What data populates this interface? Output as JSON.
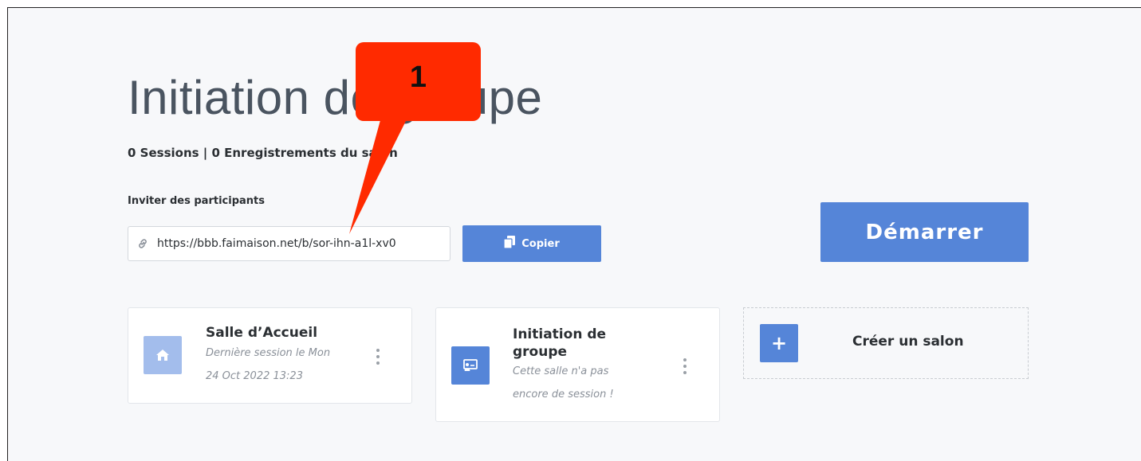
{
  "room": {
    "title": "Initiation de groupe",
    "stats": "0 Sessions | 0 Enregistrements du salon"
  },
  "invite": {
    "label": "Inviter des participants",
    "url": "https://bbb.faimaison.net/b/sor-ihn-a1l-xv0",
    "link_icon": "link-icon",
    "copy_label": "Copier",
    "copy_icon": "copy-icon"
  },
  "start_label": "Démarrer",
  "rooms": [
    {
      "title": "Salle d’Accueil",
      "subtitle_lines": [
        "Dernière session le Mon",
        "24 Oct 2022 13:23"
      ],
      "icon": "home-icon"
    },
    {
      "title_lines": [
        "Initiation de",
        "groupe"
      ],
      "subtitle_lines": [
        "Cette salle n'a pas",
        "encore de session !"
      ],
      "icon": "presentation-icon"
    }
  ],
  "create_room": {
    "label": "Créer un salon",
    "icon": "plus-icon"
  },
  "annotation": {
    "number": "1"
  },
  "colors": {
    "accent": "#5585d8",
    "home_icon_bg": "#a3bdec",
    "callout": "#ff2a00",
    "title_text": "#4a5460"
  }
}
